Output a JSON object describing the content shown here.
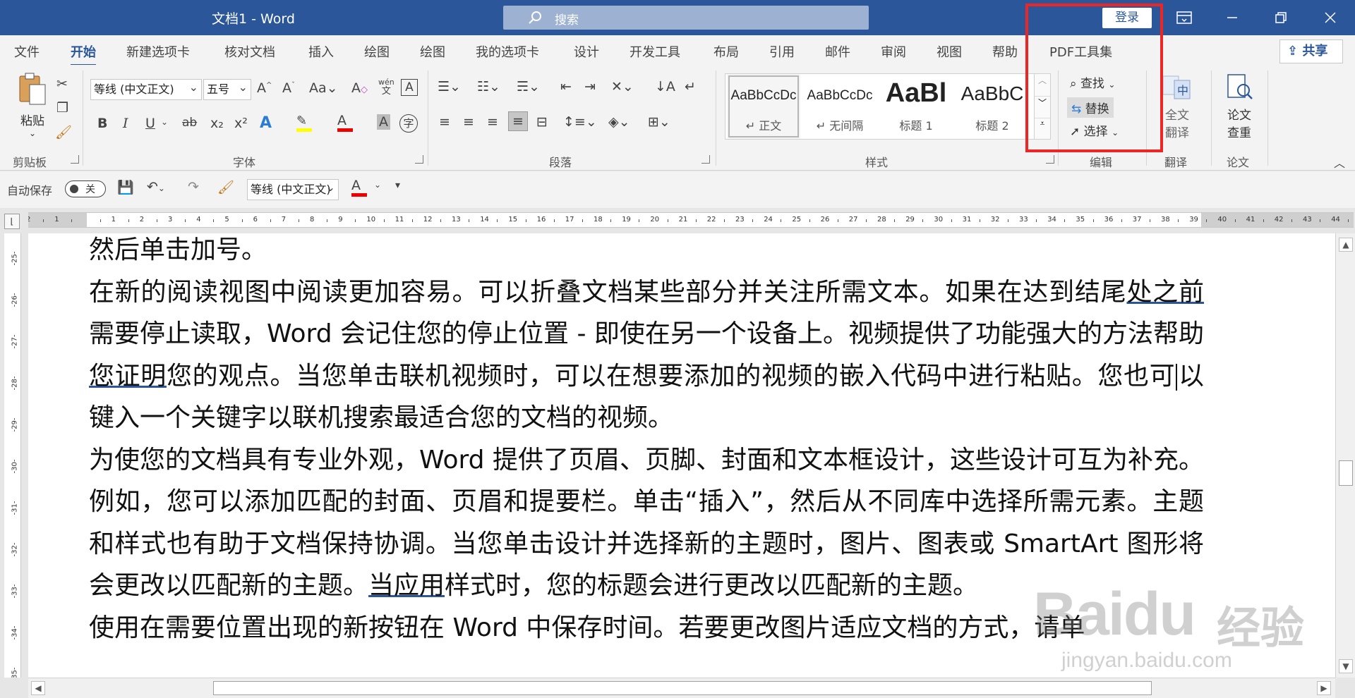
{
  "titlebar": {
    "doc_title": "文档1",
    "separator": "-",
    "app_name": "Word",
    "search_placeholder": "搜索",
    "login_label": "登录",
    "ribbon_display_icon": "ribbon-display-icon",
    "minimize_icon": "minimize-icon",
    "restore_icon": "restore-icon",
    "close_icon": "close-icon"
  },
  "tabs": [
    "文件",
    "开始",
    "新建选项卡",
    "核对文档",
    "插入",
    "绘图",
    "绘图",
    "我的选项卡",
    "设计",
    "开发工具",
    "布局",
    "引用",
    "邮件",
    "审阅",
    "视图",
    "帮助",
    "PDF工具集"
  ],
  "active_tab": "开始",
  "share_label": "共享",
  "ribbon": {
    "clipboard": {
      "label": "剪贴板",
      "paste_label": "粘贴"
    },
    "font": {
      "label": "字体",
      "font_name": "等线 (中文正文)",
      "font_size": "五号",
      "grow_font": "A^",
      "shrink_font": "A˅",
      "change_case": "Aa",
      "bold": "B",
      "italic": "I",
      "underline": "U",
      "strike": "ab",
      "subscript": "x₂",
      "superscript": "x²",
      "phonetic": "wén"
    },
    "paragraph": {
      "label": "段落"
    },
    "styles": {
      "label": "样式",
      "items": [
        {
          "sample": "AaBbCcDc",
          "name": "正文"
        },
        {
          "sample": "AaBbCcDc",
          "name": "无间隔"
        },
        {
          "sample": "AaBl",
          "name": "标题 1"
        },
        {
          "sample": "AaBbC",
          "name": "标题 2"
        }
      ]
    },
    "editing": {
      "label": "编辑",
      "find_label": "查找",
      "replace_label": "替换",
      "select_label": "选择"
    },
    "translate": {
      "label": "翻译",
      "button_label_1": "全文",
      "button_label_2": "翻译"
    },
    "paper": {
      "label": "论文",
      "button_label_1": "论文",
      "button_label_2": "查重"
    }
  },
  "qat": {
    "autosave_label": "自动保存",
    "toggle_state": "关",
    "font_name": "等线 (中文正文)"
  },
  "ruler_ticks": [
    "2",
    "1",
    "",
    "1",
    "2",
    "3",
    "4",
    "5",
    "6",
    "7",
    "8",
    "9",
    "10",
    "11",
    "12",
    "13",
    "14",
    "15",
    "16",
    "17",
    "18",
    "19",
    "20",
    "21",
    "22",
    "23",
    "24",
    "25",
    "26",
    "27",
    "28",
    "29",
    "30",
    "31",
    "32",
    "33",
    "34",
    "35",
    "36",
    "37",
    "38",
    "39",
    "40",
    "41",
    "42",
    "43",
    "44"
  ],
  "vruler_ticks": [
    "25",
    "26",
    "27",
    "28",
    "29",
    "30",
    "31",
    "32",
    "33",
    "34",
    "35"
  ],
  "document": {
    "line_top": "然后单击加号。",
    "p1_a": "在新的阅读视图中阅读更加容易。可以折叠文档某些部分并关注所需文本。如果在达到结尾",
    "p1_b_underline": "处之前",
    "p1_c": "需要停止读取，Word 会记住您的停止位置 - 即使在另一个设备上。视频提供了功能强大的方法帮助",
    "p1_d_underline": "您证明",
    "p1_e": "您的观点。当您单击联机视频时，可以在想要添加的视频的嵌入代码中进行粘贴。您也可",
    "p1_f": "以键入一个关键字以联机搜索最适合您的文档的视频。",
    "p2_a": "为使您的文档具有专业外观，Word 提供了页眉、页脚、封面和文本框设计，这些设计可互为补充。例如，您可以添加匹配的封面、页眉和提要栏。单击“插入”，然后从不同库中选择所需元素。主题和样式也有助于文档保持协调。当您单击设计并选择新的主题时，图片、图表或 SmartArt 图形将会更改以匹配新的主题。",
    "p2_b_underline": "当应用",
    "p2_c": "样式时，您的标题会进行更改以匹配新的主题。",
    "p3": "使用在需要位置出现的新按钮在 Word 中保存时间。若要更改图片适应文档的方式，请单"
  },
  "watermark": {
    "brand": "Baidu",
    "cn": "经验",
    "url": "jingyan.baidu.com"
  }
}
